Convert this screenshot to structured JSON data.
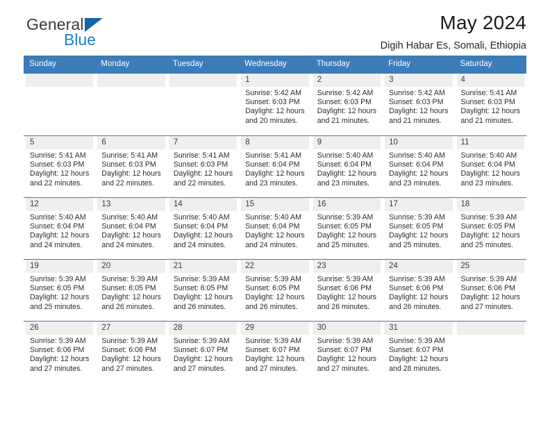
{
  "brand": {
    "name_top": "General",
    "name_bottom": "Blue",
    "accent_color": "#1f80d2",
    "triangle_color": "#1464aa"
  },
  "header": {
    "title": "May 2024",
    "subtitle": "Digih Habar Es, Somali, Ethiopia"
  },
  "calendar": {
    "header_bg": "#3c7cb8",
    "daynum_bg": "#efefef",
    "weekdays": [
      "Sunday",
      "Monday",
      "Tuesday",
      "Wednesday",
      "Thursday",
      "Friday",
      "Saturday"
    ],
    "weeks": [
      [
        {
          "day": "",
          "empty": true
        },
        {
          "day": "",
          "empty": true
        },
        {
          "day": "",
          "empty": true
        },
        {
          "day": "1",
          "sunrise": "Sunrise: 5:42 AM",
          "sunset": "Sunset: 6:03 PM",
          "daylight_line1": "Daylight: 12 hours",
          "daylight_line2": "and 20 minutes."
        },
        {
          "day": "2",
          "sunrise": "Sunrise: 5:42 AM",
          "sunset": "Sunset: 6:03 PM",
          "daylight_line1": "Daylight: 12 hours",
          "daylight_line2": "and 21 minutes."
        },
        {
          "day": "3",
          "sunrise": "Sunrise: 5:42 AM",
          "sunset": "Sunset: 6:03 PM",
          "daylight_line1": "Daylight: 12 hours",
          "daylight_line2": "and 21 minutes."
        },
        {
          "day": "4",
          "sunrise": "Sunrise: 5:41 AM",
          "sunset": "Sunset: 6:03 PM",
          "daylight_line1": "Daylight: 12 hours",
          "daylight_line2": "and 21 minutes."
        }
      ],
      [
        {
          "day": "5",
          "sunrise": "Sunrise: 5:41 AM",
          "sunset": "Sunset: 6:03 PM",
          "daylight_line1": "Daylight: 12 hours",
          "daylight_line2": "and 22 minutes."
        },
        {
          "day": "6",
          "sunrise": "Sunrise: 5:41 AM",
          "sunset": "Sunset: 6:03 PM",
          "daylight_line1": "Daylight: 12 hours",
          "daylight_line2": "and 22 minutes."
        },
        {
          "day": "7",
          "sunrise": "Sunrise: 5:41 AM",
          "sunset": "Sunset: 6:03 PM",
          "daylight_line1": "Daylight: 12 hours",
          "daylight_line2": "and 22 minutes."
        },
        {
          "day": "8",
          "sunrise": "Sunrise: 5:41 AM",
          "sunset": "Sunset: 6:04 PM",
          "daylight_line1": "Daylight: 12 hours",
          "daylight_line2": "and 23 minutes."
        },
        {
          "day": "9",
          "sunrise": "Sunrise: 5:40 AM",
          "sunset": "Sunset: 6:04 PM",
          "daylight_line1": "Daylight: 12 hours",
          "daylight_line2": "and 23 minutes."
        },
        {
          "day": "10",
          "sunrise": "Sunrise: 5:40 AM",
          "sunset": "Sunset: 6:04 PM",
          "daylight_line1": "Daylight: 12 hours",
          "daylight_line2": "and 23 minutes."
        },
        {
          "day": "11",
          "sunrise": "Sunrise: 5:40 AM",
          "sunset": "Sunset: 6:04 PM",
          "daylight_line1": "Daylight: 12 hours",
          "daylight_line2": "and 23 minutes."
        }
      ],
      [
        {
          "day": "12",
          "sunrise": "Sunrise: 5:40 AM",
          "sunset": "Sunset: 6:04 PM",
          "daylight_line1": "Daylight: 12 hours",
          "daylight_line2": "and 24 minutes."
        },
        {
          "day": "13",
          "sunrise": "Sunrise: 5:40 AM",
          "sunset": "Sunset: 6:04 PM",
          "daylight_line1": "Daylight: 12 hours",
          "daylight_line2": "and 24 minutes."
        },
        {
          "day": "14",
          "sunrise": "Sunrise: 5:40 AM",
          "sunset": "Sunset: 6:04 PM",
          "daylight_line1": "Daylight: 12 hours",
          "daylight_line2": "and 24 minutes."
        },
        {
          "day": "15",
          "sunrise": "Sunrise: 5:40 AM",
          "sunset": "Sunset: 6:04 PM",
          "daylight_line1": "Daylight: 12 hours",
          "daylight_line2": "and 24 minutes."
        },
        {
          "day": "16",
          "sunrise": "Sunrise: 5:39 AM",
          "sunset": "Sunset: 6:05 PM",
          "daylight_line1": "Daylight: 12 hours",
          "daylight_line2": "and 25 minutes."
        },
        {
          "day": "17",
          "sunrise": "Sunrise: 5:39 AM",
          "sunset": "Sunset: 6:05 PM",
          "daylight_line1": "Daylight: 12 hours",
          "daylight_line2": "and 25 minutes."
        },
        {
          "day": "18",
          "sunrise": "Sunrise: 5:39 AM",
          "sunset": "Sunset: 6:05 PM",
          "daylight_line1": "Daylight: 12 hours",
          "daylight_line2": "and 25 minutes."
        }
      ],
      [
        {
          "day": "19",
          "sunrise": "Sunrise: 5:39 AM",
          "sunset": "Sunset: 6:05 PM",
          "daylight_line1": "Daylight: 12 hours",
          "daylight_line2": "and 25 minutes."
        },
        {
          "day": "20",
          "sunrise": "Sunrise: 5:39 AM",
          "sunset": "Sunset: 6:05 PM",
          "daylight_line1": "Daylight: 12 hours",
          "daylight_line2": "and 26 minutes."
        },
        {
          "day": "21",
          "sunrise": "Sunrise: 5:39 AM",
          "sunset": "Sunset: 6:05 PM",
          "daylight_line1": "Daylight: 12 hours",
          "daylight_line2": "and 26 minutes."
        },
        {
          "day": "22",
          "sunrise": "Sunrise: 5:39 AM",
          "sunset": "Sunset: 6:05 PM",
          "daylight_line1": "Daylight: 12 hours",
          "daylight_line2": "and 26 minutes."
        },
        {
          "day": "23",
          "sunrise": "Sunrise: 5:39 AM",
          "sunset": "Sunset: 6:06 PM",
          "daylight_line1": "Daylight: 12 hours",
          "daylight_line2": "and 26 minutes."
        },
        {
          "day": "24",
          "sunrise": "Sunrise: 5:39 AM",
          "sunset": "Sunset: 6:06 PM",
          "daylight_line1": "Daylight: 12 hours",
          "daylight_line2": "and 26 minutes."
        },
        {
          "day": "25",
          "sunrise": "Sunrise: 5:39 AM",
          "sunset": "Sunset: 6:06 PM",
          "daylight_line1": "Daylight: 12 hours",
          "daylight_line2": "and 27 minutes."
        }
      ],
      [
        {
          "day": "26",
          "sunrise": "Sunrise: 5:39 AM",
          "sunset": "Sunset: 6:06 PM",
          "daylight_line1": "Daylight: 12 hours",
          "daylight_line2": "and 27 minutes."
        },
        {
          "day": "27",
          "sunrise": "Sunrise: 5:39 AM",
          "sunset": "Sunset: 6:06 PM",
          "daylight_line1": "Daylight: 12 hours",
          "daylight_line2": "and 27 minutes."
        },
        {
          "day": "28",
          "sunrise": "Sunrise: 5:39 AM",
          "sunset": "Sunset: 6:07 PM",
          "daylight_line1": "Daylight: 12 hours",
          "daylight_line2": "and 27 minutes."
        },
        {
          "day": "29",
          "sunrise": "Sunrise: 5:39 AM",
          "sunset": "Sunset: 6:07 PM",
          "daylight_line1": "Daylight: 12 hours",
          "daylight_line2": "and 27 minutes."
        },
        {
          "day": "30",
          "sunrise": "Sunrise: 5:39 AM",
          "sunset": "Sunset: 6:07 PM",
          "daylight_line1": "Daylight: 12 hours",
          "daylight_line2": "and 27 minutes."
        },
        {
          "day": "31",
          "sunrise": "Sunrise: 5:39 AM",
          "sunset": "Sunset: 6:07 PM",
          "daylight_line1": "Daylight: 12 hours",
          "daylight_line2": "and 28 minutes."
        },
        {
          "day": "",
          "empty": true
        }
      ]
    ]
  }
}
